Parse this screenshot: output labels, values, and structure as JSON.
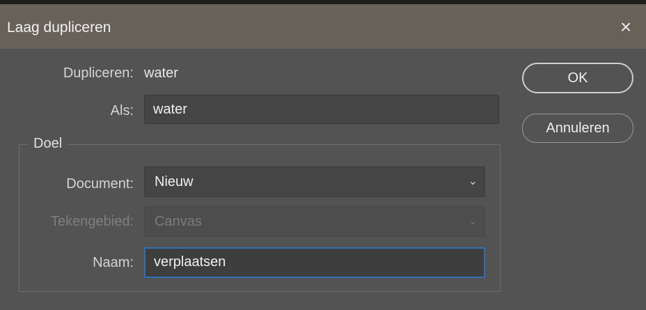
{
  "dialog": {
    "title": "Laag dupliceren",
    "close_glyph": "×"
  },
  "duplicate": {
    "label": "Dupliceren:",
    "value": "water"
  },
  "as": {
    "label": "Als:",
    "value": "water"
  },
  "target": {
    "legend": "Doel",
    "document": {
      "label": "Document:",
      "selected": "Nieuw"
    },
    "artboard": {
      "label": "Tekengebied:",
      "selected": "Canvas",
      "disabled": true
    },
    "name": {
      "label": "Naam:",
      "value": "verplaatsen"
    }
  },
  "buttons": {
    "ok": "OK",
    "cancel": "Annuleren"
  },
  "colors": {
    "titlebar": "#686158",
    "background": "#535353",
    "focus_border": "#2f6fb6"
  }
}
